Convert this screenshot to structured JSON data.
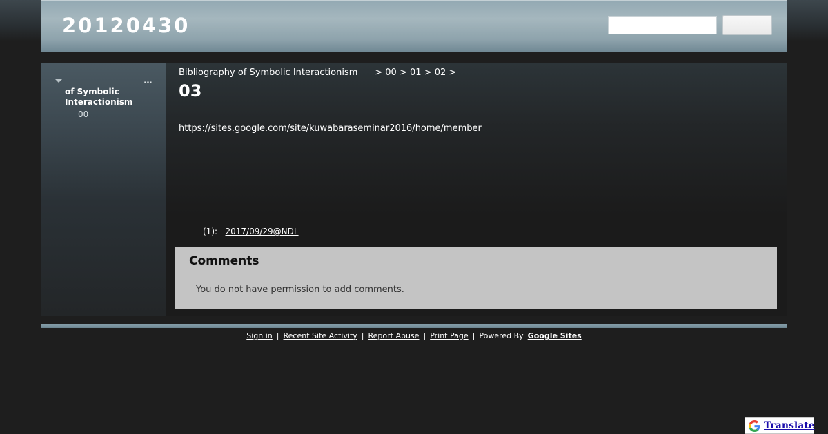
{
  "header": {
    "site_title": "20120430",
    "search_placeholder": "",
    "search_button_label": ""
  },
  "sidebar": {
    "more_label": "...",
    "items": [
      {
        "label": "of Symbolic Interactionism"
      },
      {
        "label": "00"
      }
    ]
  },
  "breadcrumb": {
    "items": [
      {
        "label": "Bibliography of Symbolic Interactionism     "
      },
      {
        "label": "00"
      },
      {
        "label": "01"
      },
      {
        "label": "02"
      }
    ],
    "separator": ">"
  },
  "page": {
    "title": "03",
    "body_text": "https://sites.google.com/site/kuwabaraseminar2016/home/member",
    "version_prefix": "(1):",
    "version_link": "2017/09/29@NDL"
  },
  "comments": {
    "title": "Comments",
    "permission_text": "You do not have permission to add comments."
  },
  "footer": {
    "sign_in": "Sign in",
    "recent_activity": "Recent Site Activity",
    "report_abuse": "Report Abuse",
    "print_page": "Print Page",
    "powered_by": "Powered By",
    "google_sites": "Google Sites",
    "separator": "|"
  },
  "translate": {
    "label": "Translate",
    "icon": "google-g-icon"
  },
  "colors": {
    "background": "#1e1e1e",
    "header": "#a5b7be",
    "comments_bg": "#c4c4c4",
    "translate_link": "#1a0dab"
  }
}
